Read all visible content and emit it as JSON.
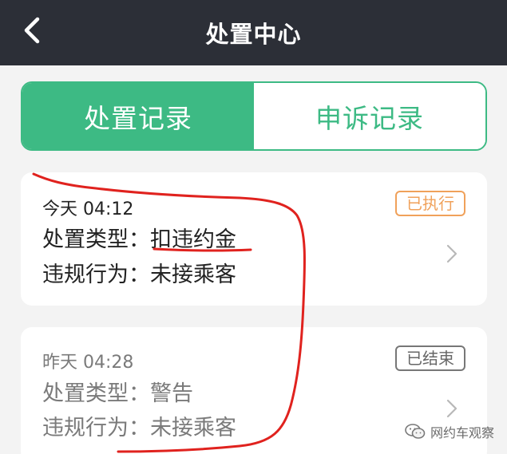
{
  "header": {
    "title": "处置中心"
  },
  "tabs": [
    {
      "label": "处置记录",
      "active": true
    },
    {
      "label": "申诉记录",
      "active": false
    }
  ],
  "records": [
    {
      "time": "今天 04:12",
      "status": "已执行",
      "type_label": "处置类型：",
      "type_value": "扣违约金",
      "behavior_label": "违规行为：",
      "behavior_value": "未接乘客"
    },
    {
      "time": "昨天 04:28",
      "status": "已结束",
      "type_label": "处置类型：",
      "type_value": "警告",
      "behavior_label": "违规行为：",
      "behavior_value": "未接乘客"
    }
  ],
  "watermark": {
    "text": "网约车观察",
    "icon": "wechat-icon"
  },
  "colors": {
    "header_bg": "#2c2f37",
    "accent": "#3dba84",
    "badge_executed": "#f0a15a",
    "badge_ended": "#777777",
    "annotation": "#e0221e"
  }
}
